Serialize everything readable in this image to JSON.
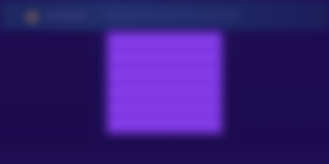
{
  "colors": {
    "background": "#1e0d52",
    "topbar": "#223470",
    "panel": "#7c33e0",
    "panel_row": "#8a45ee",
    "avatar": "#5a4a5e"
  },
  "header": {
    "avatar_icon": "avatar-icon"
  }
}
